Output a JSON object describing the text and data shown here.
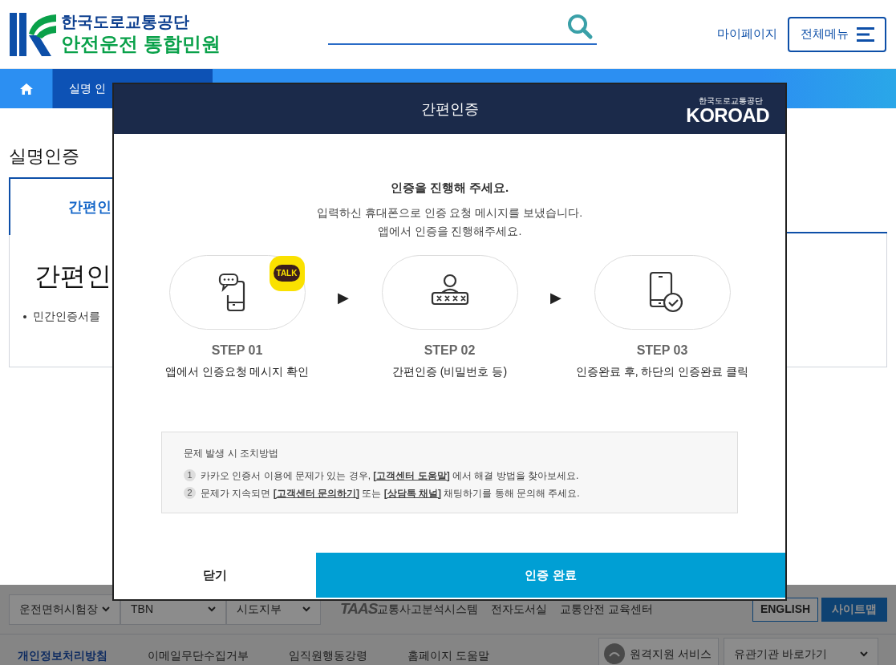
{
  "header": {
    "org_name": "한국도로교통공단",
    "service_name": "안전운전 통합민원",
    "my_page": "마이페이지",
    "menu_button": "전체메뉴"
  },
  "breadcrumb": [
    {
      "kind": "home"
    },
    {
      "kind": "current",
      "label": "실명 인"
    }
  ],
  "page": {
    "title": "실명인증",
    "tabs": [
      {
        "label": "간편인",
        "selected": true
      }
    ],
    "heading": "간편인",
    "bullets": [
      "민간인증서를"
    ]
  },
  "modal": {
    "title": "간편인증",
    "logo_caption": "한국도로교통공단",
    "logo": "KOROAD",
    "prompt": "인증을 진행해 주세요.",
    "message": [
      "입력하신 휴대폰으로 인증 요청 메시지를 보냈습니다.",
      "앱에서 인증을 진행해주세요."
    ],
    "steps": [
      {
        "kind": "message",
        "badge": "TALK",
        "step": "STEP 01",
        "description": "앱에서 인증요청 메시지 확인"
      },
      {
        "kind": "password",
        "step": "STEP 02",
        "description": "간편인증 (비밀번호 등)"
      },
      {
        "kind": "done",
        "step": "STEP 03",
        "description": "인증완료 후, 하단의 인증완료 클릭"
      }
    ],
    "arrow": "▶",
    "help": {
      "title": "문제 발생 시 조치방법",
      "items": [
        {
          "number": "1",
          "text": "카카오 인증서 이용에 문제가 있는 경우, **[고객센터 도움말]** 에서 해결 방법을 찾아보세요."
        },
        {
          "number": "2",
          "text": "문제가 지속되면 **[고객센터 문의하기]** 또는 **[상담톡 채널]** 채팅하기를 통해 문의해 주세요."
        }
      ]
    },
    "buttons": [
      {
        "kind": "secondary",
        "label": "닫기"
      },
      {
        "kind": "primary",
        "label": "인증 완료"
      }
    ]
  },
  "footer": {
    "selects": [
      "운전면허시험장",
      "TBN",
      "시도지부"
    ],
    "links": [
      {
        "kind": "taas",
        "logo": "TAAS",
        "label": "교통사고분석시스템"
      },
      {
        "kind": "text",
        "label": "전자도서실"
      },
      {
        "kind": "text",
        "label": "교통안전 교육센터"
      }
    ],
    "buttons": [
      {
        "kind": "outline",
        "label": "ENGLISH"
      },
      {
        "kind": "filled",
        "label": "사이트맵"
      }
    ],
    "bottom_links": [
      "개인정보처리방침",
      "이메일무단수집거부",
      "임직원행동강령",
      "홈페이지 도움말"
    ],
    "remote_support": "원격지원 서비스",
    "related_sites": "유관기관 바로가기"
  }
}
